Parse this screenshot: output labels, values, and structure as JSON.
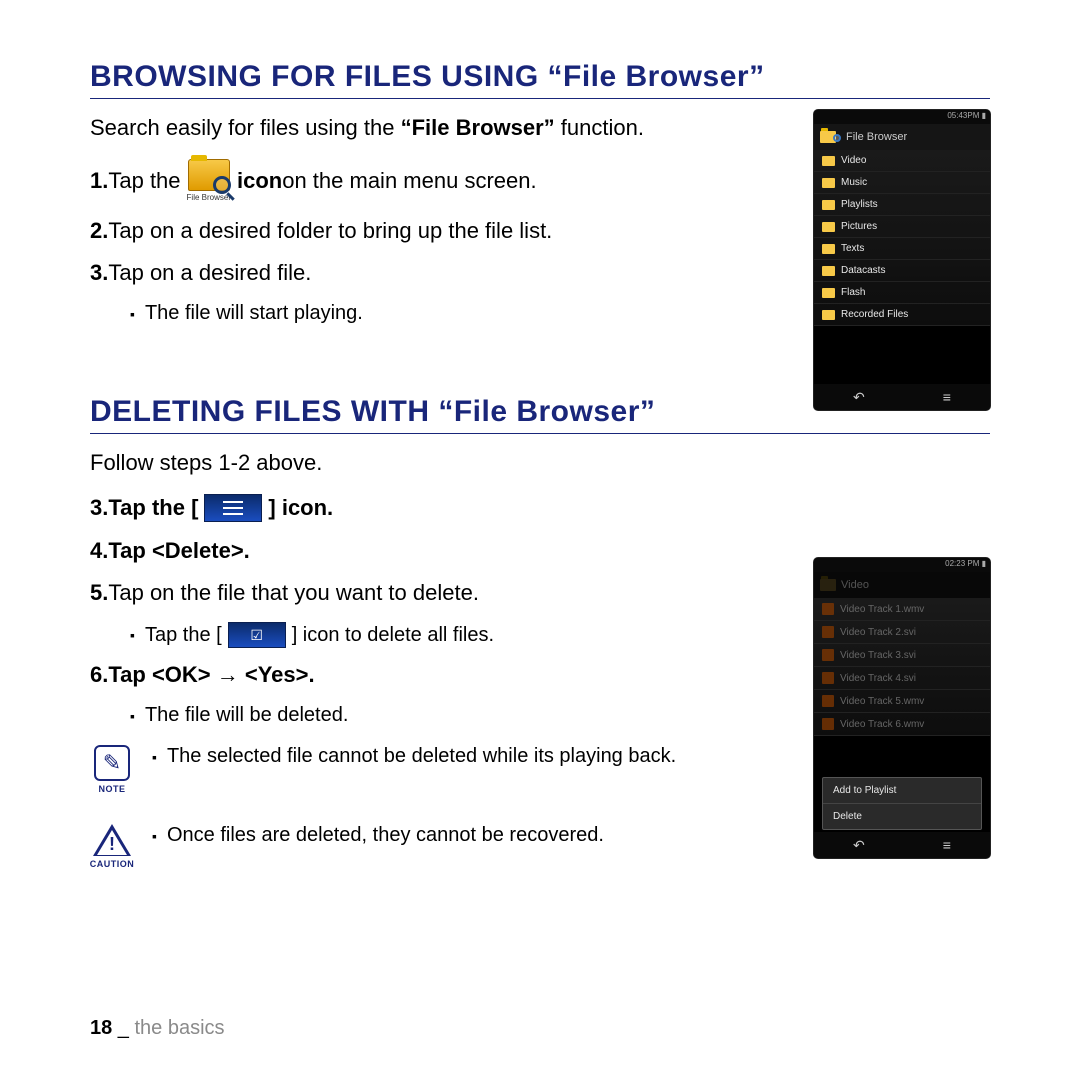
{
  "section1": {
    "title": "BROWSING FOR FILES USING “File Browser”",
    "intro_pre": "Search easily for files using the ",
    "intro_bold": "“File Browser”",
    "intro_post": " function.",
    "step1_num": "1.",
    "step1_pre": " Tap the ",
    "step1_bold": " icon",
    "step1_post": " on the main menu screen.",
    "icon_caption": "File Browser",
    "step2_num": "2.",
    "step2_text": " Tap on a desired folder to bring up the file list.",
    "step3_num": "3.",
    "step3_text": " Tap on a desired file.",
    "sub1": "The file will start playing."
  },
  "section2": {
    "title": "DELETING FILES WITH “File Browser”",
    "intro": "Follow steps 1-2 above.",
    "step3_num": "3.",
    "step3_pre": " Tap the [ ",
    "step3_post": " ] icon.",
    "step4_num": "4.",
    "step4_text": " Tap <Delete>.",
    "step5_num": "5.",
    "step5_text": " Tap on the file that you want to delete.",
    "sub5_pre": "Tap the [ ",
    "sub5_post": " ] icon to delete all files.",
    "step6_num": "6.",
    "step6_text": " Tap <OK> → <Yes>.",
    "sub6": "The file will be deleted.",
    "note_label": "NOTE",
    "note_text": "The selected file cannot be deleted while its playing back.",
    "caution_label": "CAUTION",
    "caution_text": "Once files are deleted, they cannot be recovered."
  },
  "phone1": {
    "status": "05:43PM ▮",
    "title": "File Browser",
    "folders": [
      "Video",
      "Music",
      "Playlists",
      "Pictures",
      "Texts",
      "Datacasts",
      "Flash",
      "Recorded Files"
    ]
  },
  "phone2": {
    "status": "02:23 PM ▮",
    "title": "Video",
    "files": [
      "Video Track 1.wmv",
      "Video Track 2.svi",
      "Video Track 3.svi",
      "Video Track 4.svi",
      "Video Track 5.wmv",
      "Video Track 6.wmv"
    ],
    "popup": [
      "Add to Playlist",
      "Delete"
    ]
  },
  "footer": {
    "page": "18",
    "sep": " _ ",
    "section": "the basics"
  }
}
